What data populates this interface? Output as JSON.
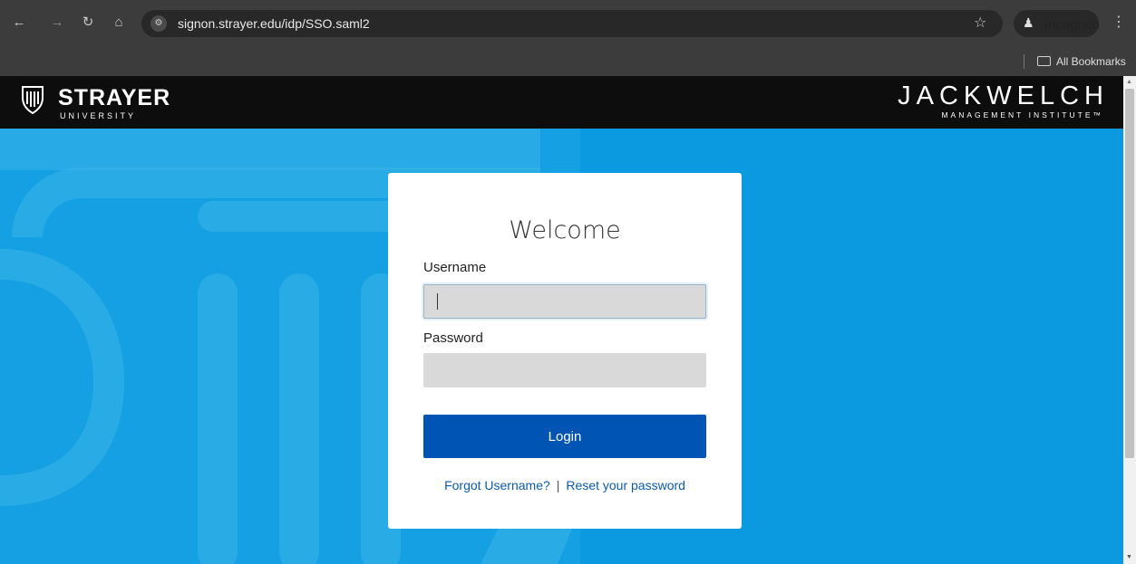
{
  "browser": {
    "url": "signon.strayer.edu/idp/SSO.saml2",
    "incognito_label": "Incognito",
    "all_bookmarks_label": "All Bookmarks",
    "icons": {
      "back": "back-arrow-icon",
      "forward": "forward-arrow-icon",
      "reload": "reload-icon",
      "home": "home-icon",
      "site_info": "site-info-icon",
      "bookmark": "star-icon",
      "incognito": "incognito-icon",
      "menu": "kebab-menu-icon",
      "folder": "folder-icon"
    }
  },
  "header": {
    "strayer_name": "STRAYER",
    "strayer_sub": "UNIVERSITY",
    "jw_name": "JACKWELCH",
    "jw_sub": "MANAGEMENT INSTITUTE™"
  },
  "login": {
    "title": "Welcome",
    "username_label": "Username",
    "username_value": "",
    "password_label": "Password",
    "password_value": "",
    "login_button": "Login",
    "forgot_username": "Forgot Username?",
    "separator": "|",
    "reset_password": "Reset your password"
  },
  "colors": {
    "page_background": "#0b9ae0",
    "header_background": "#0d0d0d",
    "login_button": "#0054b4",
    "link": "#0d5aa8",
    "input_background": "#d9d9d9"
  }
}
